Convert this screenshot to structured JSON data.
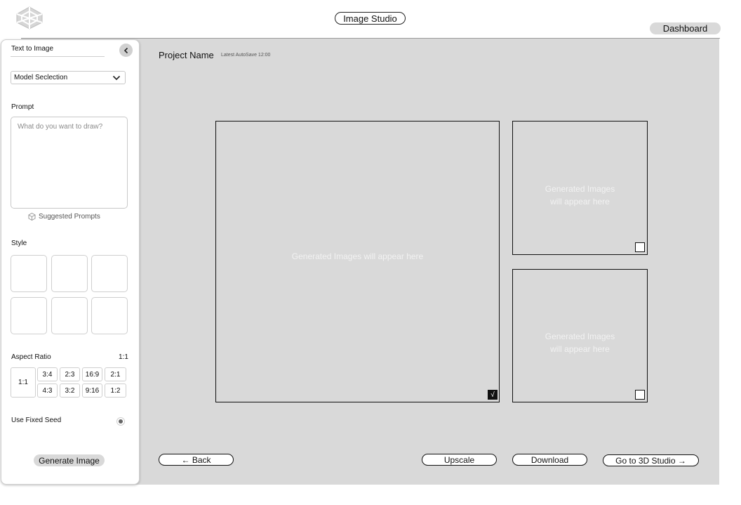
{
  "header": {
    "logo_icon": "cube-logo-icon",
    "studio_title": "Image Studio",
    "dashboard_label": "Dashboard"
  },
  "sidebar": {
    "mode_label": "Text to Image",
    "collapse_icon": "chevron-left-icon",
    "model_select": {
      "value": "Model Seclection",
      "icon": "chevron-down-icon"
    },
    "prompt": {
      "label": "Prompt",
      "placeholder": "What do you want to draw?",
      "suggested_label": "Suggested Prompts",
      "suggested_icon": "cube-icon"
    },
    "style": {
      "label": "Style",
      "tile_count": 6
    },
    "aspect_ratio": {
      "label": "Aspect Ratio",
      "current": "1:1",
      "options": [
        "1:1",
        "3:4",
        "2:3",
        "16:9",
        "2:1",
        "4:3",
        "3:2",
        "9:16",
        "1:2"
      ]
    },
    "fixed_seed": {
      "label": "Use Fixed Seed",
      "checked": true
    },
    "generate_label": "Generate Image"
  },
  "main": {
    "project_name": "Project Name",
    "autosave": "Latest AutoSave 12:00",
    "images": [
      {
        "text": "Generated Images will appear here",
        "selected": true
      },
      {
        "line1": "Generated Images",
        "line2": "will appear here",
        "selected": false
      },
      {
        "line1": "Generated Images",
        "line2": "will appear here",
        "selected": false
      }
    ],
    "buttons": {
      "back": "← Back",
      "upscale": "Upscale",
      "download": "Download",
      "studio3d": "Go to 3D Studio →"
    }
  },
  "colors": {
    "canvas": "#d9d9d9",
    "accent_dark": "#111111",
    "pill_gray": "#d9d9d9"
  }
}
